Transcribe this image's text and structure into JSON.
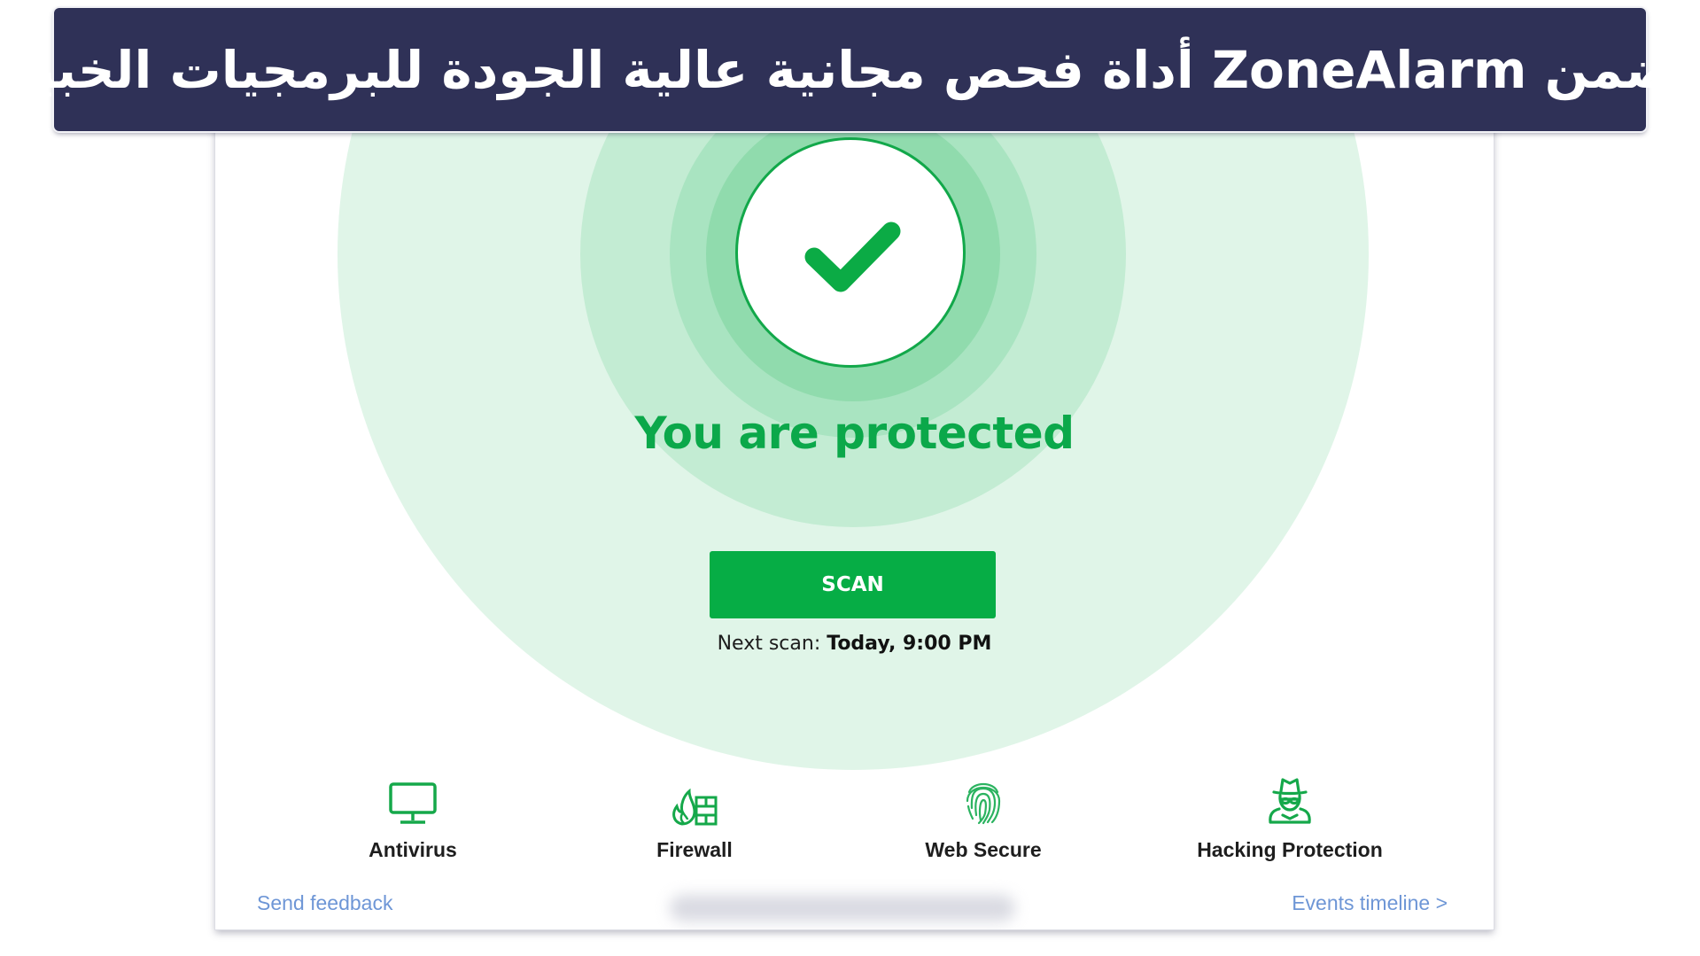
{
  "banner": {
    "title": "يتضمن ZoneAlarm أداة فحص مجانية عالية الجودة للبرمجيات الخبيثة"
  },
  "app": {
    "status_icon": "checkmark-icon",
    "status_title": "You are protected",
    "scan_button_label": "SCAN",
    "next_scan_label": "Next scan:",
    "next_scan_value": "Today, 9:00 PM",
    "features": [
      {
        "label": "Antivirus",
        "icon": "monitor-icon"
      },
      {
        "label": "Firewall",
        "icon": "firewall-icon"
      },
      {
        "label": "Web Secure",
        "icon": "fingerprint-icon"
      },
      {
        "label": "Hacking Protection",
        "icon": "spy-icon"
      }
    ],
    "footer": {
      "send_feedback": "Send feedback",
      "events_timeline": "Events timeline >"
    },
    "colors": {
      "accent_green": "#06ad45",
      "link_blue": "#6e96d6",
      "banner_navy": "#2f3157"
    }
  }
}
